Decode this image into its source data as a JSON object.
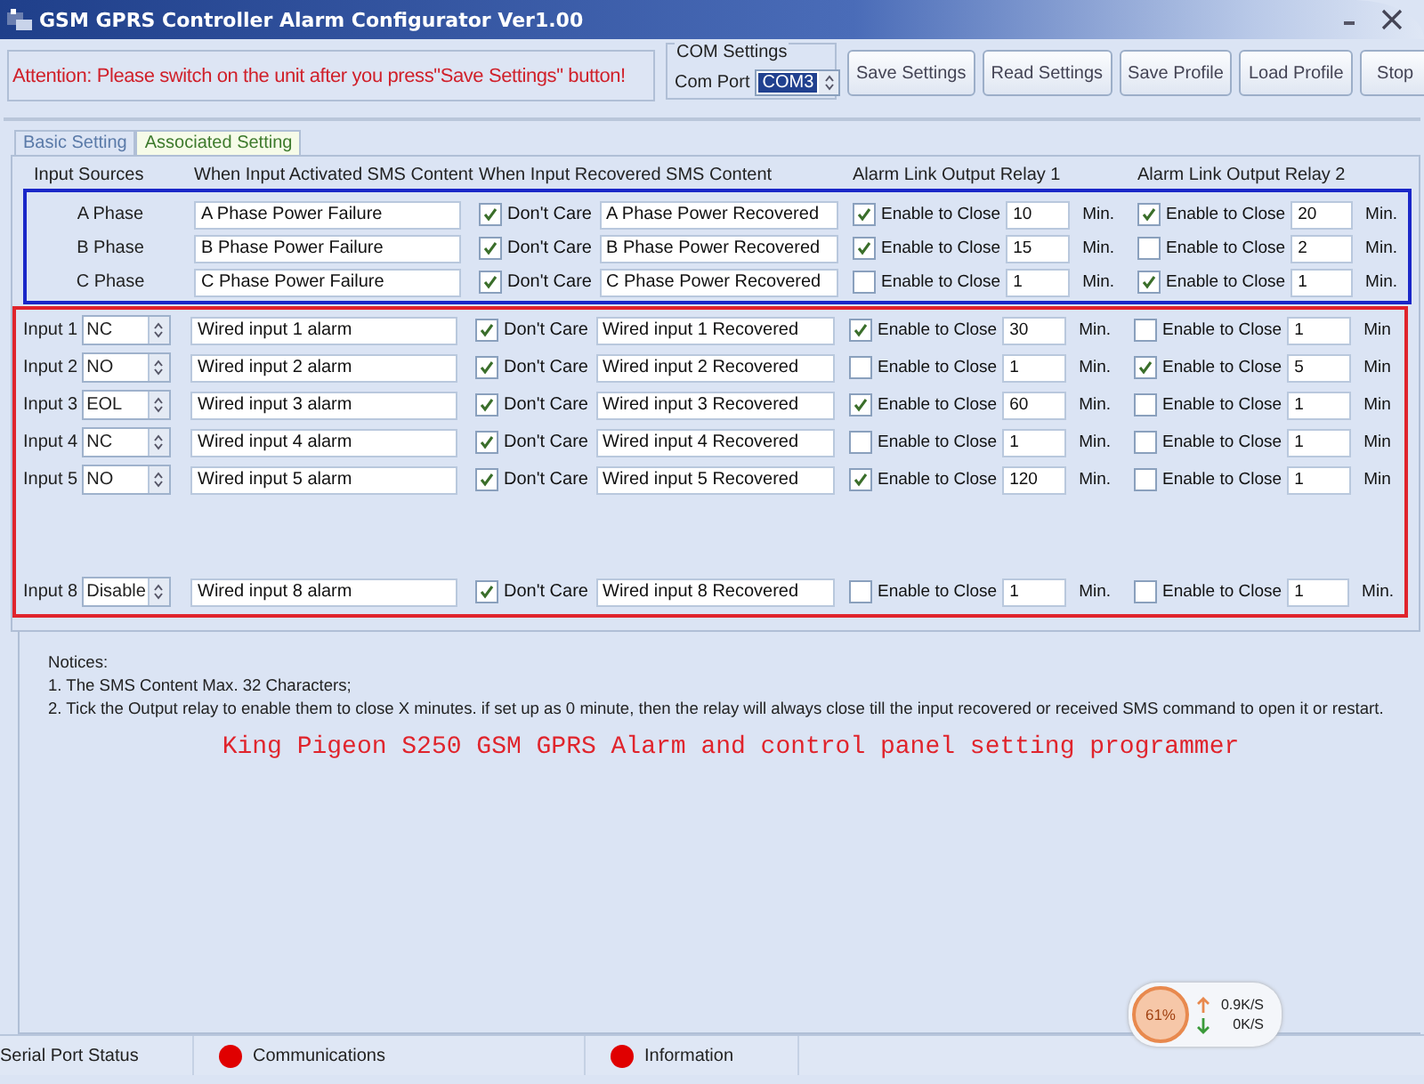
{
  "window": {
    "title": "GSM GPRS Controller Alarm Configurator Ver1.00"
  },
  "attention": "Attention: Please switch on the unit after you press\"Save Settings\" button!",
  "com_settings": {
    "title": "COM Settings",
    "label": "Com Port",
    "value": "COM3"
  },
  "buttons": [
    "Save Settings",
    "Read Settings",
    "Save Profile",
    "Load Profile",
    "Stop"
  ],
  "tabs": [
    {
      "label": "Basic Setting",
      "selected": false
    },
    {
      "label": "Associated Setting",
      "selected": true
    }
  ],
  "columns": [
    "Input Sources",
    "When Input Activated SMS Content",
    "When Input Recovered SMS Content",
    "Alarm Link Output Relay 1",
    "Alarm Link Output Relay 2"
  ],
  "phase_rows": [
    {
      "source": "A Phase",
      "activated": "A Phase Power Failure",
      "dont_care": {
        "checked": true,
        "label": "Don't Care"
      },
      "recovered": "A Phase Power Recovered",
      "relay1": {
        "checked": true,
        "label": "Enable to Close",
        "minutes": "10",
        "unit": "Min."
      },
      "relay2": {
        "checked": true,
        "label": "Enable to Close",
        "minutes": "20",
        "unit": "Min."
      }
    },
    {
      "source": "B Phase",
      "activated": "B Phase Power Failure",
      "dont_care": {
        "checked": true,
        "label": "Don't Care"
      },
      "recovered": "B Phase Power Recovered",
      "relay1": {
        "checked": true,
        "label": "Enable to Close",
        "minutes": "15",
        "unit": "Min."
      },
      "relay2": {
        "checked": false,
        "label": "Enable to Close",
        "minutes": "2",
        "unit": "Min."
      }
    },
    {
      "source": "C Phase",
      "activated": "C Phase Power Failure",
      "dont_care": {
        "checked": true,
        "label": "Don't Care"
      },
      "recovered": "C Phase Power Recovered",
      "relay1": {
        "checked": false,
        "label": "Enable to Close",
        "minutes": "1",
        "unit": "Min."
      },
      "relay2": {
        "checked": true,
        "label": "Enable to Close",
        "minutes": "1",
        "unit": "Min."
      }
    }
  ],
  "input_rows": [
    {
      "source": "Input 1",
      "mode": "NC",
      "activated": "Wired input 1 alarm",
      "dont_care": {
        "checked": true,
        "label": "Don't Care"
      },
      "recovered": "Wired input 1 Recovered",
      "relay1": {
        "checked": true,
        "label": "Enable to Close",
        "minutes": "30",
        "unit": "Min."
      },
      "relay2": {
        "checked": false,
        "label": "Enable to Close",
        "minutes": "1",
        "unit": "Min"
      }
    },
    {
      "source": "Input 2",
      "mode": "NO",
      "activated": "Wired input 2 alarm",
      "dont_care": {
        "checked": true,
        "label": "Don't Care"
      },
      "recovered": "Wired input 2 Recovered",
      "relay1": {
        "checked": false,
        "label": "Enable to Close",
        "minutes": "1",
        "unit": "Min."
      },
      "relay2": {
        "checked": true,
        "label": "Enable to Close",
        "minutes": "5",
        "unit": "Min"
      }
    },
    {
      "source": "Input 3",
      "mode": "EOL",
      "activated": "Wired input 3 alarm",
      "dont_care": {
        "checked": true,
        "label": "Don't Care"
      },
      "recovered": "Wired input 3 Recovered",
      "relay1": {
        "checked": true,
        "label": "Enable to Close",
        "minutes": "60",
        "unit": "Min."
      },
      "relay2": {
        "checked": false,
        "label": "Enable to Close",
        "minutes": "1",
        "unit": "Min"
      }
    },
    {
      "source": "Input 4",
      "mode": "NC",
      "activated": "Wired input 4 alarm",
      "dont_care": {
        "checked": true,
        "label": "Don't Care"
      },
      "recovered": "Wired input 4 Recovered",
      "relay1": {
        "checked": false,
        "label": "Enable to Close",
        "minutes": "1",
        "unit": "Min."
      },
      "relay2": {
        "checked": false,
        "label": "Enable to Close",
        "minutes": "1",
        "unit": "Min"
      }
    },
    {
      "source": "Input 5",
      "mode": "NO",
      "activated": "Wired input 5 alarm",
      "dont_care": {
        "checked": true,
        "label": "Don't Care"
      },
      "recovered": "Wired input 5 Recovered",
      "relay1": {
        "checked": true,
        "label": "Enable to Close",
        "minutes": "120",
        "unit": "Min."
      },
      "relay2": {
        "checked": false,
        "label": "Enable to Close",
        "minutes": "1",
        "unit": "Min"
      }
    },
    {
      "source": "Input 8",
      "mode": "Disable",
      "activated": "Wired input 8 alarm",
      "dont_care": {
        "checked": true,
        "label": "Don't Care"
      },
      "recovered": "Wired input 8 Recovered",
      "relay1": {
        "checked": false,
        "label": "Enable to Close",
        "minutes": "1",
        "unit": "Min."
      },
      "relay2": {
        "checked": false,
        "label": "Enable to Close",
        "minutes": "1",
        "unit": "Min."
      }
    }
  ],
  "notices": [
    "Notices:",
    "1. The SMS Content Max. 32 Characters;",
    "2. Tick the Output relay to enable them to close X minutes. if set up as 0 minute, then the relay will always close till the input recovered or received SMS command to open it or restart."
  ],
  "caption": "King Pigeon S250 GSM GPRS Alarm and control panel setting programmer",
  "speed_widget": {
    "percent": "61%",
    "upload": "0.9K/S",
    "download": "0K/S"
  },
  "status_bar": [
    {
      "kind": "text",
      "label": "Serial Port Status"
    },
    {
      "kind": "indicator",
      "label": "Communications",
      "color": "#e00000"
    },
    {
      "kind": "indicator",
      "label": "Information",
      "color": "#e00000"
    }
  ]
}
